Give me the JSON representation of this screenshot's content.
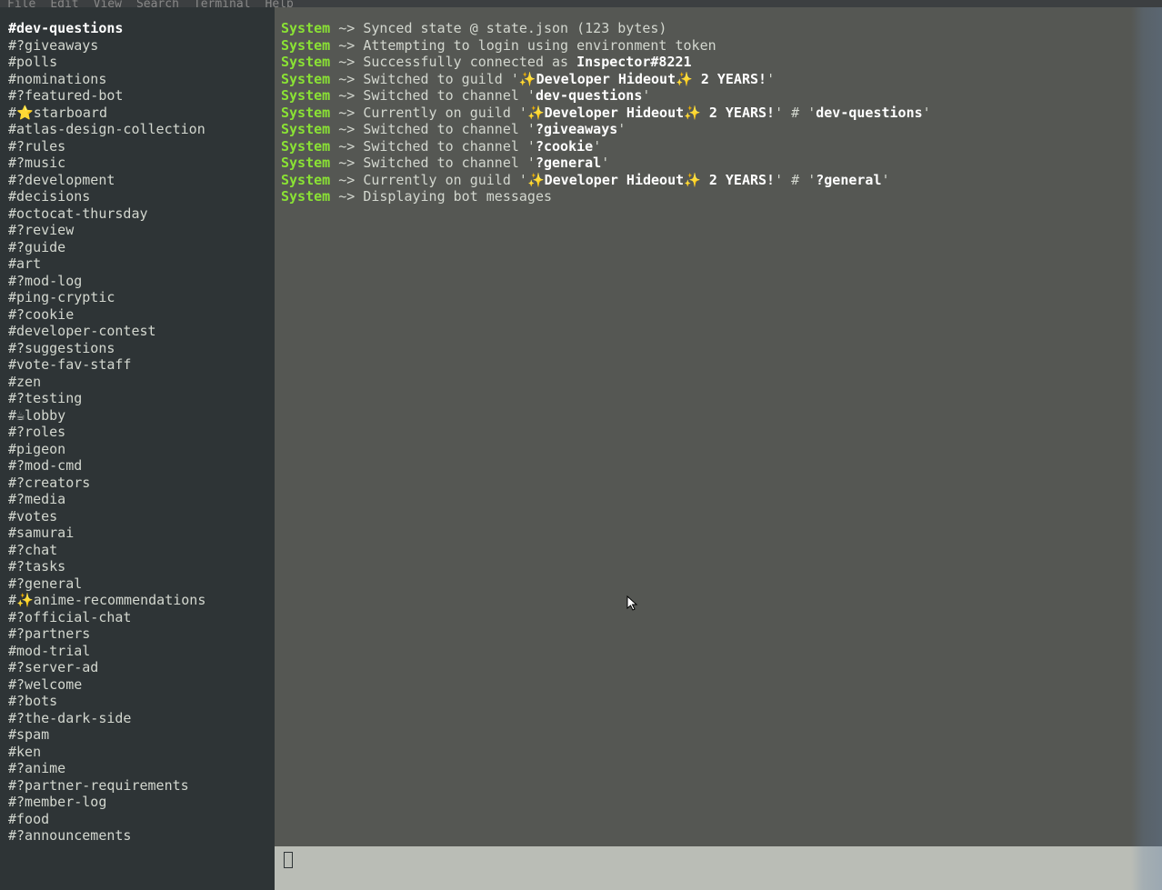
{
  "menubar": [
    "File",
    "Edit",
    "View",
    "Search",
    "Terminal",
    "Help"
  ],
  "channels": [
    {
      "label": "#dev-questions",
      "active": true
    },
    {
      "label": "#?giveaways"
    },
    {
      "label": "#polls"
    },
    {
      "label": "#nominations"
    },
    {
      "label": "#?featured-bot"
    },
    {
      "label": "#⭐starboard"
    },
    {
      "label": "#atlas-design-collection"
    },
    {
      "label": "#?rules"
    },
    {
      "label": "#?music"
    },
    {
      "label": "#?development"
    },
    {
      "label": "#decisions"
    },
    {
      "label": "#octocat-thursday"
    },
    {
      "label": "#?review"
    },
    {
      "label": "#?guide"
    },
    {
      "label": "#art"
    },
    {
      "label": "#?mod-log"
    },
    {
      "label": "#ping-cryptic"
    },
    {
      "label": "#?cookie"
    },
    {
      "label": "#developer-contest"
    },
    {
      "label": "#?suggestions"
    },
    {
      "label": "#vote-fav-staff"
    },
    {
      "label": "#zen"
    },
    {
      "label": "#?testing"
    },
    {
      "label": "#☕lobby"
    },
    {
      "label": "#?roles"
    },
    {
      "label": "#pigeon"
    },
    {
      "label": "#?mod-cmd"
    },
    {
      "label": "#?creators"
    },
    {
      "label": "#?media"
    },
    {
      "label": "#votes"
    },
    {
      "label": "#samurai"
    },
    {
      "label": "#?chat"
    },
    {
      "label": "#?tasks"
    },
    {
      "label": "#?general"
    },
    {
      "label": "#✨anime-recommendations"
    },
    {
      "label": "#?official-chat"
    },
    {
      "label": "#?partners"
    },
    {
      "label": "#mod-trial"
    },
    {
      "label": "#?server-ad"
    },
    {
      "label": "#?welcome"
    },
    {
      "label": "#?bots"
    },
    {
      "label": "#?the-dark-side"
    },
    {
      "label": "#spam"
    },
    {
      "label": "#ken"
    },
    {
      "label": "#?anime"
    },
    {
      "label": "#?partner-requirements"
    },
    {
      "label": "#?member-log"
    },
    {
      "label": "#food"
    },
    {
      "label": "#?announcements"
    }
  ],
  "log": [
    {
      "parts": [
        {
          "t": "sys",
          "v": "System"
        },
        {
          "t": "arrow",
          "v": " ~> "
        },
        {
          "t": "txt",
          "v": "Synced state @ state.json (123 bytes)"
        }
      ]
    },
    {
      "parts": [
        {
          "t": "sys",
          "v": "System"
        },
        {
          "t": "arrow",
          "v": " ~> "
        },
        {
          "t": "txt",
          "v": "Attempting to login using environment token"
        }
      ]
    },
    {
      "parts": [
        {
          "t": "sys",
          "v": "System"
        },
        {
          "t": "arrow",
          "v": " ~> "
        },
        {
          "t": "txt",
          "v": "Successfully connected as "
        },
        {
          "t": "bold",
          "v": "Inspector#8221"
        }
      ]
    },
    {
      "parts": [
        {
          "t": "sys",
          "v": "System"
        },
        {
          "t": "arrow",
          "v": " ~> "
        },
        {
          "t": "txt",
          "v": "Switched to guild '"
        },
        {
          "t": "bold",
          "v": "✨Developer Hideout✨ 2 YEARS!"
        },
        {
          "t": "txt",
          "v": "'"
        }
      ]
    },
    {
      "parts": [
        {
          "t": "sys",
          "v": "System"
        },
        {
          "t": "arrow",
          "v": " ~> "
        },
        {
          "t": "txt",
          "v": "Switched to channel '"
        },
        {
          "t": "bold",
          "v": "dev-questions"
        },
        {
          "t": "txt",
          "v": "'"
        }
      ]
    },
    {
      "parts": [
        {
          "t": "sys",
          "v": "System"
        },
        {
          "t": "arrow",
          "v": " ~> "
        },
        {
          "t": "txt",
          "v": "Currently on guild '"
        },
        {
          "t": "bold",
          "v": "✨Developer Hideout✨ 2 YEARS!"
        },
        {
          "t": "txt",
          "v": "' # '"
        },
        {
          "t": "bold",
          "v": "dev-questions"
        },
        {
          "t": "txt",
          "v": "'"
        }
      ]
    },
    {
      "parts": [
        {
          "t": "sys",
          "v": "System"
        },
        {
          "t": "arrow",
          "v": " ~> "
        },
        {
          "t": "txt",
          "v": "Switched to channel '"
        },
        {
          "t": "bold",
          "v": "?giveaways"
        },
        {
          "t": "txt",
          "v": "'"
        }
      ]
    },
    {
      "parts": [
        {
          "t": "sys",
          "v": "System"
        },
        {
          "t": "arrow",
          "v": " ~> "
        },
        {
          "t": "txt",
          "v": "Switched to channel '"
        },
        {
          "t": "bold",
          "v": "?cookie"
        },
        {
          "t": "txt",
          "v": "'"
        }
      ]
    },
    {
      "parts": [
        {
          "t": "sys",
          "v": "System"
        },
        {
          "t": "arrow",
          "v": " ~> "
        },
        {
          "t": "txt",
          "v": "Switched to channel '"
        },
        {
          "t": "bold",
          "v": "?general"
        },
        {
          "t": "txt",
          "v": "'"
        }
      ]
    },
    {
      "parts": [
        {
          "t": "sys",
          "v": "System"
        },
        {
          "t": "arrow",
          "v": " ~> "
        },
        {
          "t": "txt",
          "v": "Currently on guild '"
        },
        {
          "t": "bold",
          "v": "✨Developer Hideout✨ 2 YEARS!"
        },
        {
          "t": "txt",
          "v": "' # '"
        },
        {
          "t": "bold",
          "v": "?general"
        },
        {
          "t": "txt",
          "v": "'"
        }
      ]
    },
    {
      "parts": [
        {
          "t": "sys",
          "v": "System"
        },
        {
          "t": "arrow",
          "v": " ~> "
        },
        {
          "t": "txt",
          "v": "Displaying bot messages"
        }
      ]
    }
  ]
}
